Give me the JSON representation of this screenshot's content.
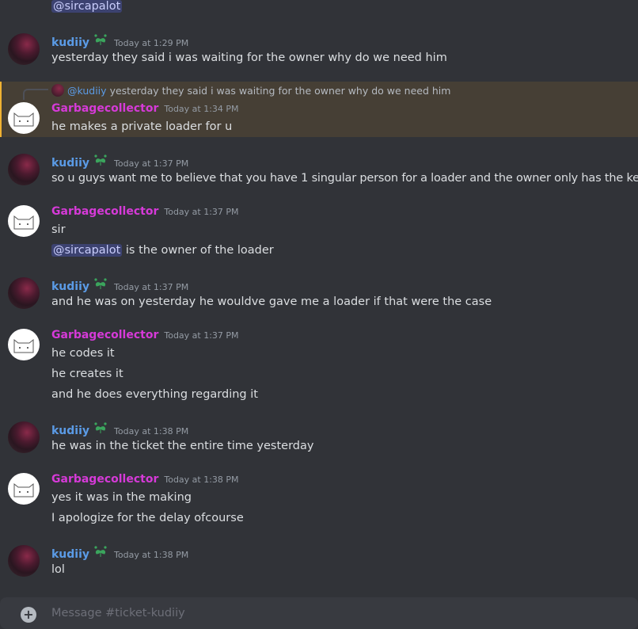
{
  "top_mention": "@sircapalot",
  "users": {
    "kudiiy": "kudiiy",
    "garbage": "Garbagecollector"
  },
  "reply": {
    "name": "@kudiiy",
    "text": "yesterday they said i was waiting for the owner why do we need him"
  },
  "messages": [
    {
      "time": "Today at 1:29 PM",
      "lines": [
        "yesterday they said i was waiting for the owner why do we need him"
      ]
    },
    {
      "time": "Today at 1:34 PM",
      "lines": [
        "he makes a private loader for u"
      ]
    },
    {
      "time": "Today at 1:37 PM",
      "lines": [
        "so u guys want me to believe that you have 1 singular person for a loader and the owner only has the keys"
      ]
    },
    {
      "time": "Today at 1:37 PM",
      "lines": [
        "sir"
      ],
      "mention": "@sircapalot",
      "mention_suffix": " is the owner of the loader"
    },
    {
      "time": "Today at 1:37 PM",
      "lines": [
        "and he was on yesterday he wouldve gave me a loader if that were the case"
      ]
    },
    {
      "time": "Today at 1:37 PM",
      "lines": [
        "he codes it",
        "he creates it",
        "and he does everything regarding it"
      ]
    },
    {
      "time": "Today at 1:38 PM",
      "lines": [
        "he was in the ticket the entire time yesterday"
      ]
    },
    {
      "time": "Today at 1:38 PM",
      "lines": [
        "yes it was in the making",
        "I apologize for the delay ofcourse"
      ]
    },
    {
      "time": "Today at 1:38 PM",
      "lines": [
        "lol"
      ]
    }
  ],
  "composer": {
    "placeholder": "Message #ticket-kudiiy"
  },
  "colors": {
    "kudiiy": "#5b9be6",
    "garbage": "#d63ad8",
    "background": "#313338",
    "highlight": "#463f35"
  }
}
